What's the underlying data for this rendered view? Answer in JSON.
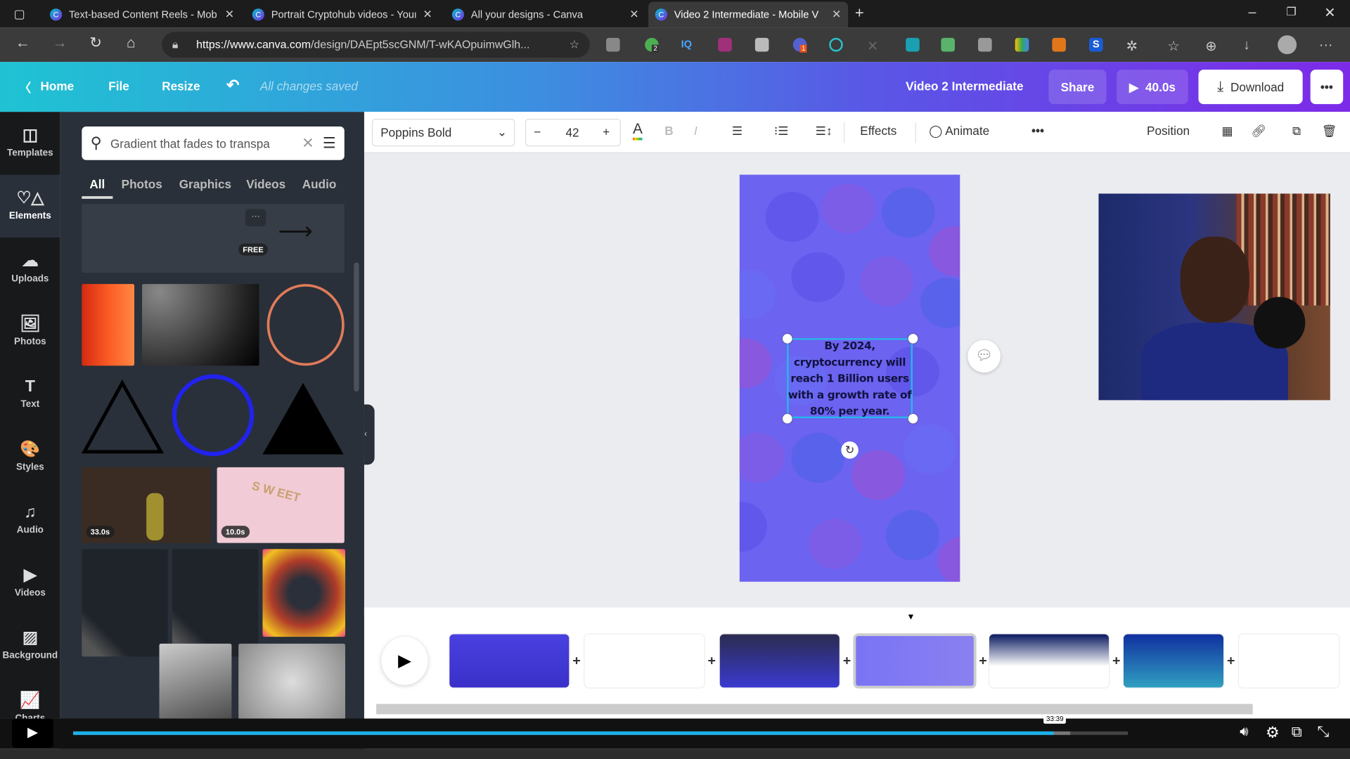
{
  "browser": {
    "tabs": [
      {
        "title": "Text-based Content Reels - Mob",
        "active": false
      },
      {
        "title": "Portrait Cryptohub videos - Your",
        "active": false
      },
      {
        "title": "All your designs - Canva",
        "active": false
      },
      {
        "title": "Video 2 Intermediate - Mobile V",
        "active": true
      }
    ],
    "url_host": "https://www.canva.com",
    "url_path": "/design/DAEpt5scGNM/T-wKAOpuimwGlh...",
    "ext_badges": {
      "shield": "2",
      "gear": "1"
    }
  },
  "header": {
    "home": "Home",
    "file": "File",
    "resize": "Resize",
    "saved_status": "All changes saved",
    "design_title": "Video 2 Intermediate",
    "share": "Share",
    "play_duration": "40.0s",
    "download": "Download"
  },
  "rail": {
    "items": [
      {
        "label": "Templates",
        "icon": "templates-icon",
        "glyph": "◫"
      },
      {
        "label": "Elements",
        "icon": "elements-icon",
        "glyph": "♡△",
        "active": true
      },
      {
        "label": "Uploads",
        "icon": "upload-cloud-icon",
        "glyph": "☁"
      },
      {
        "label": "Photos",
        "icon": "image-icon",
        "glyph": "🖼"
      },
      {
        "label": "Text",
        "icon": "text-icon",
        "glyph": "T"
      },
      {
        "label": "Styles",
        "icon": "palette-icon",
        "glyph": "🎨"
      },
      {
        "label": "Audio",
        "icon": "music-note-icon",
        "glyph": "♫"
      },
      {
        "label": "Videos",
        "icon": "video-icon",
        "glyph": "▶"
      },
      {
        "label": "Background",
        "icon": "background-stripes-icon",
        "glyph": "▨"
      },
      {
        "label": "Charts",
        "icon": "chart-line-icon",
        "glyph": "📈"
      }
    ]
  },
  "panel": {
    "search_value": "Gradient that fades to transpa",
    "tabs": [
      "All",
      "Photos",
      "Graphics",
      "Videos",
      "Audio"
    ],
    "active_tab": "All",
    "free_badge": "FREE",
    "video_badges": [
      "33.0s",
      "10.0s"
    ]
  },
  "toolbar": {
    "font": "Poppins Bold",
    "font_size": "42",
    "effects": "Effects",
    "animate": "Animate",
    "position": "Position"
  },
  "canvas": {
    "text": "By 2024, cryptocurrency will reach 1 Billion users with a growth rate of 80% per year.",
    "page_color": "#6c63f0"
  },
  "player": {
    "time_tooltip": "33:39",
    "progress_fraction": 0.93,
    "buffered_fraction": 0.99
  }
}
